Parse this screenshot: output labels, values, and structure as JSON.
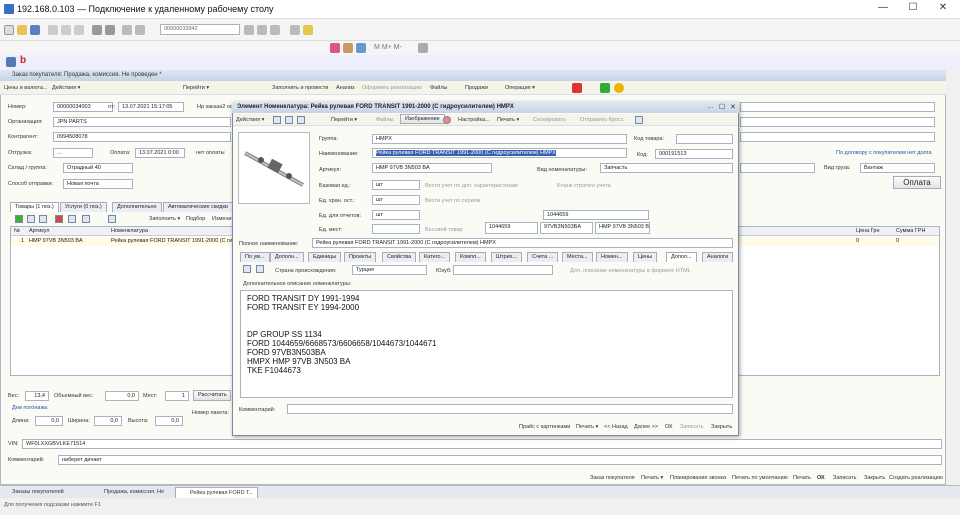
{
  "window": {
    "title": "192.168.0.103 — Подключение к удаленному рабочему столу",
    "min": "—",
    "max": "☐",
    "close": "✕"
  },
  "toolbar": {
    "search_value": "00000033942"
  },
  "appbar": {
    "logo": "b"
  },
  "bgform": {
    "title": "Заказ покупателя: Продажа, комиссия. Не проведен *",
    "cmd": [
      "Цены и валюта...",
      "Действия ▾",
      "Перейти ▾",
      "Заполнить и провести",
      "Анализ",
      "Оформить реализацию",
      "Файлы",
      "Продажи",
      "Операция ▾"
    ],
    "fields": {
      "nomer_label": "Номер:",
      "nomer": "00000034003",
      "ot_label": "от:",
      "ot": "13.07.2021 15:17:05",
      "zakaz_label": "Нр заказа2 ос",
      "org_label": "Организация:",
      "org": "JPN PARTS",
      "kontr_label": "Контрагент:",
      "kontr": "0994508078",
      "otgr_label": "Отгрузка:",
      "otgr": "...",
      "oplata_label": "Оплата:",
      "oplata": "13.07.2021 0:00",
      "net_oplaty": "нет оплаты",
      "sklad_label": "Склад / группа:",
      "sklad": "Отрадный 40",
      "sposob_label": "Способ отправки:",
      "sposob": "Новая почта",
      "dogovor_link": "По договору с покупателем нет долга",
      "vid_gruz_label": "Вид груза:",
      "vid_gruz": "Вантаж",
      "oplata_btn": "Оплата"
    },
    "tabs": [
      "Товары (1 поз.)",
      "Услуги (0 поз.)",
      "Дополнительно",
      "Автоматические скидки"
    ],
    "grid_tools": [
      "Заполнить ▾",
      "Подбор",
      "Изменить"
    ],
    "grid_head": [
      "№",
      "Артикул",
      "Номенклатура",
      "Цена Грн",
      "Сумма ГРН"
    ],
    "row": {
      "n": "1",
      "art": "HMP 97VB 3N503 BA",
      "nom": "Рейка рулевая FORD TRANSIT 1991-2000 (С ги",
      "price": "0",
      "sum": "0"
    },
    "bottom": {
      "ves_label": "Вес:",
      "ves": "13,4",
      "obves_label": "Объемный вес:",
      "obves": "0,0",
      "mest_label": "Мест:",
      "mest": "1",
      "rasschitat": "Рассчитать",
      "dims_label": "Дни погонажа",
      "dlina_label": "Длина:",
      "dlina": "0,0",
      "shirina_label": "Ширина:",
      "shirina": "0,0",
      "vysota_label": "Высота:",
      "vysota": "0,0",
      "nomer_paketa_label": "Номер пакета:",
      "vin_label": "VIN:",
      "vin": "WF0LXXGBVLKE71514",
      "komm_label": "Комментарий:",
      "komm": "наберет дичает"
    },
    "footer": [
      "Заказ покупателя",
      "Печать ▾",
      "Планирование звонка",
      "Печать по умолчанию",
      "Печать",
      "ОК",
      "Записать",
      "Закрыть",
      "Создать реализацию"
    ]
  },
  "dialog": {
    "title": "Элемент Номенклатура: Рейка рулевая FORD TRANSIT 1991-2000 (С гидроусилителем) HMPX",
    "cmd": [
      "Действия ▾",
      "Перейти ▾",
      "Файлы",
      "Изображение",
      "Настройка...",
      "Печать ▾",
      "Скопировать",
      "Отправить Кросс"
    ],
    "labels": {
      "gruppa": "Группа:",
      "naimen": "Наименование:",
      "artikul": "Артикул:",
      "baz_ed": "Базовая ед.:",
      "ed_hran": "Ед. хран. ост.:",
      "ed_otch": "Ед. для отчетов:",
      "ed_mest": "Ед. мест:",
      "kod_tovara": "Код товара:",
      "kod": "Код:",
      "vid_nom": "Вид номенклатуры:",
      "poln_naim": "Полное наименование:",
      "vesti_ucht_dop": "Вести учет по доп. характеристикам",
      "vesti_ucht_ser": "Вести учет по сериям",
      "vesovoi": "Весовой товар",
      "blank_strog": "Бланк строгого учета"
    },
    "values": {
      "gruppa": "HMPX",
      "naimen": "Рейка рулевая FORD TRANSIT 1991-2000 (С гидроусилителем) HMPX",
      "artikul": "HMP 97VB 3N503 BA",
      "baz_ed": "шт",
      "ed_hran": "шт",
      "ed_otch": "шт",
      "kod": "000191513",
      "vid_nom": "Запчасть",
      "num1": "1044659",
      "num2": "1044659",
      "num3": "97VB3N503BA",
      "num4": "HMP 97VB 3N503 BA",
      "poln_naim": "Рейка рулевая FORD TRANSIT 1991-2000 (С гидроусилителем) HMPX"
    },
    "tabs": [
      "По ум...",
      "Дополн...",
      "Единицы",
      "Свойства",
      "Свойства",
      "Катего...",
      "Компл...",
      "Штрих...",
      "Счета ...",
      "Места...",
      "Номен...",
      "Цены",
      "Допол...",
      "Аналоги"
    ],
    "strana_label": "Страна происхождения:",
    "strana": "Турция",
    "ukvzd_label": "Юзуб:",
    "html_label": "Доп. описание номенклатуры в формате HTML",
    "dop_label": "Дополнительное описание номенклатуры:",
    "memo": "FORD TRANSIT DY 1991-1994\nFORD TRANSIT EY 1994-2000\n\n\nDP GROUP SS 1134\nFORD 1044659/6668573/6606658/1044673/1044671\nFORD 97VB3N503BA\nHMPX HMP 97VB 3N503 BA\nTKE F1044673",
    "komm_label": "Комментарий:",
    "footer": [
      "Прайс с картинками",
      "Печать ▾",
      "<< Назад",
      "Далее >>",
      "ОК",
      "Записать",
      "Закрыть"
    ]
  },
  "taskbar": [
    "Заказы покупателей",
    "Продажа, комиссия. Не",
    "Рейка рулевая FORD T..."
  ],
  "statusbar": "Для получения подсказки нажмите F1"
}
